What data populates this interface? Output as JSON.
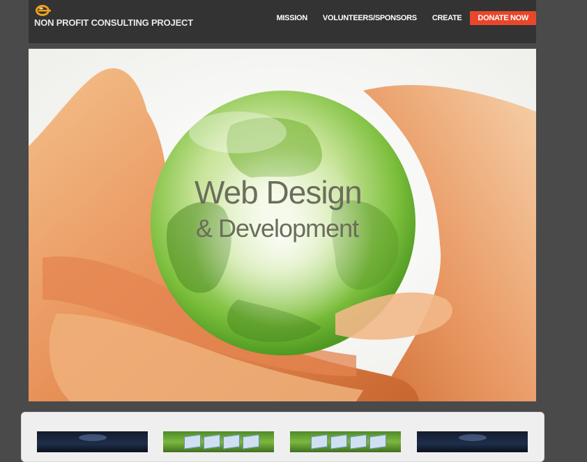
{
  "header": {
    "title": "NON PROFIT CONSULTING PROJECT",
    "logo_icon": "globe-e-logo-icon",
    "nav": [
      {
        "label": "MISSION"
      },
      {
        "label": "VOLUNTEERS/SPONSORS"
      },
      {
        "label": "CREATE"
      }
    ],
    "donate_label": "DONATE NOW",
    "colors": {
      "bar": "#333333",
      "donate": "#e8472b",
      "logo": "#f0a020"
    }
  },
  "hero": {
    "line1": "Web Design",
    "line2": "& Development",
    "description_icon": "globe-in-hands-image"
  },
  "thumbnails": [
    {
      "style": "dark"
    },
    {
      "style": "green"
    },
    {
      "style": "green"
    },
    {
      "style": "dark"
    }
  ]
}
